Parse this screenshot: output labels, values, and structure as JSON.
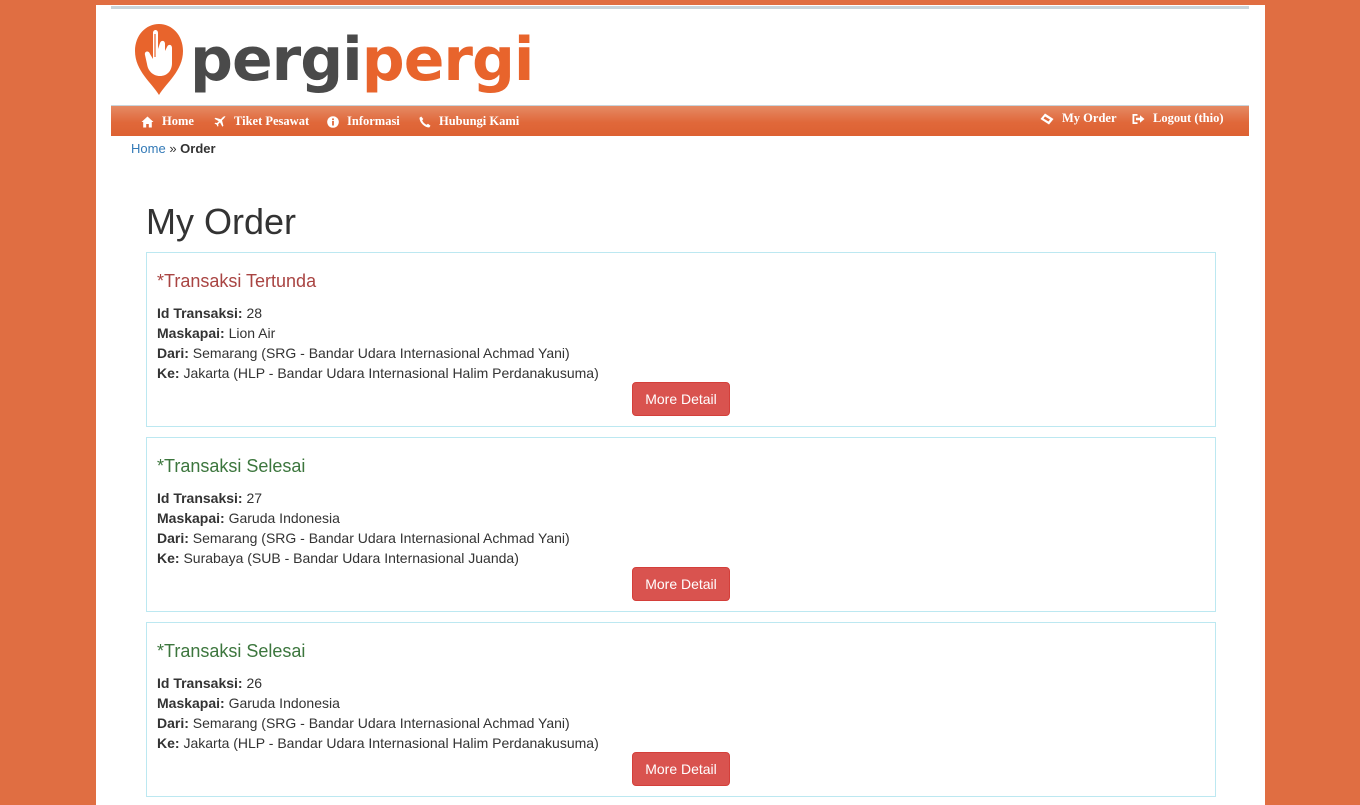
{
  "brand": {
    "part1": "pergi",
    "part2": "pergi",
    "color_dark": "#4a4a4a",
    "color_accent": "#e8642c",
    "icon": "hand-pin-icon"
  },
  "nav": {
    "left": [
      {
        "label": "Home",
        "icon": "home-icon"
      },
      {
        "label": "Tiket Pesawat",
        "icon": "plane-icon"
      },
      {
        "label": "Informasi",
        "icon": "info-icon"
      },
      {
        "label": "Hubungi Kami",
        "icon": "phone-icon"
      }
    ],
    "right": [
      {
        "label": "My Order",
        "icon": "ticket-icon"
      },
      {
        "label": "Logout (thio)",
        "icon": "logout-icon"
      }
    ]
  },
  "breadcrumb": {
    "home": "Home",
    "separator": "»",
    "current": "Order"
  },
  "page_title": "My Order",
  "labels": {
    "id": "Id Transaksi:",
    "airline": "Maskapai:",
    "from": "Dari:",
    "to": "Ke:"
  },
  "orders": [
    {
      "status": "*Transaksi Tertunda",
      "status_color": "#a94442",
      "id": "28",
      "airline": "Lion Air",
      "from": "Semarang (SRG - Bandar Udara Internasional Achmad Yani)",
      "to": "Jakarta (HLP - Bandar Udara Internasional Halim Perdanakusuma)",
      "button": "More Detail"
    },
    {
      "status": "*Transaksi Selesai",
      "status_color": "#3c763d",
      "id": "27",
      "airline": "Garuda Indonesia",
      "from": "Semarang (SRG - Bandar Udara Internasional Achmad Yani)",
      "to": "Surabaya (SUB - Bandar Udara Internasional Juanda)",
      "button": "More Detail"
    },
    {
      "status": "*Transaksi Selesai",
      "status_color": "#3c763d",
      "id": "26",
      "airline": "Garuda Indonesia",
      "from": "Semarang (SRG - Bandar Udara Internasional Achmad Yani)",
      "to": "Jakarta (HLP - Bandar Udara Internasional Halim Perdanakusuma)",
      "button": "More Detail"
    }
  ],
  "colors": {
    "background": "#e06e42",
    "navbar": "#e0683a",
    "button": "#d9534f",
    "card_border": "#bce8f1",
    "link": "#337ab7"
  }
}
